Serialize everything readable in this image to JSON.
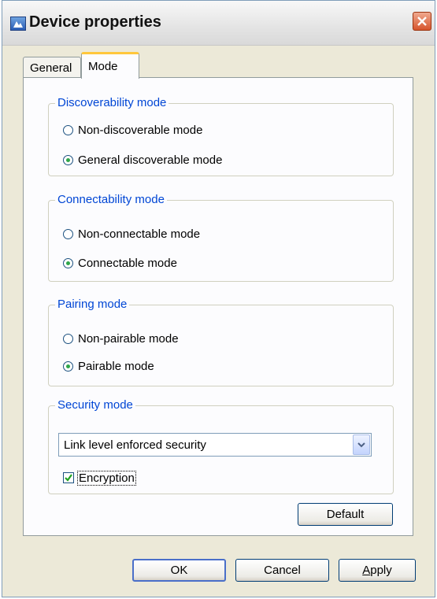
{
  "window": {
    "title": "Device properties"
  },
  "tabs": [
    {
      "label": "General",
      "selected": false
    },
    {
      "label": "Mode",
      "selected": true
    }
  ],
  "groups": {
    "discoverability": {
      "legend": "Discoverability mode",
      "options": [
        {
          "label": "Non-discoverable mode",
          "selected": false
        },
        {
          "label": "General discoverable mode",
          "selected": true
        }
      ]
    },
    "connectability": {
      "legend": "Connectability mode",
      "options": [
        {
          "label": "Non-connectable mode",
          "selected": false
        },
        {
          "label": "Connectable mode",
          "selected": true
        }
      ]
    },
    "pairing": {
      "legend": "Pairing mode",
      "options": [
        {
          "label": "Non-pairable mode",
          "selected": false
        },
        {
          "label": "Pairable mode",
          "selected": true
        }
      ]
    },
    "security": {
      "legend": "Security mode",
      "select_value": "Link level enforced security",
      "checkbox_label": "Encryption",
      "checkbox_checked": true
    }
  },
  "buttons": {
    "default": "Default",
    "ok": "OK",
    "cancel": "Cancel",
    "apply": "Apply"
  },
  "colors": {
    "legend_text": "#0046d5",
    "tab_highlight": "#ffc73c",
    "close_button": "#d6552d",
    "radio_dot": "#2fa64a"
  }
}
